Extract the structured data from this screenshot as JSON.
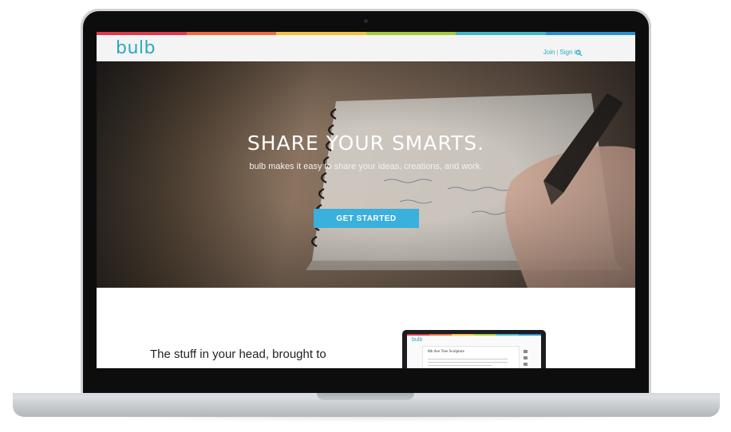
{
  "app": {
    "logo_text": "bulb",
    "brand_color": "#2aa8c6",
    "stripe_colors": [
      "#e2384b",
      "#f26b3a",
      "#f6c03d",
      "#a5cd39",
      "#3fb8c9",
      "#2a8fd1"
    ]
  },
  "header": {
    "join_label": "Join",
    "separator": "|",
    "signin_label": "Sign in",
    "search_icon": "search-icon"
  },
  "hero": {
    "title": "SHARE YOUR SMARTS.",
    "subtitle": "bulb makes it easy to share your ideas, creations, and work.",
    "cta_label": "GET STARTED",
    "cta_color": "#3ab0dc",
    "image": "notebook-and-pen-photo"
  },
  "lower": {
    "tagline": "The stuff in your head, brought to",
    "mini_preview": {
      "logo_text": "bulb",
      "card_title": "8th Ave Tree Sculpture"
    }
  }
}
